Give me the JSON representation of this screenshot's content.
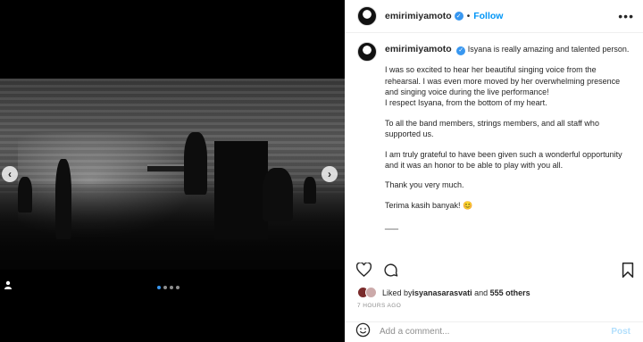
{
  "post": {
    "username": "emirimiyamoto",
    "follow_label": "Follow",
    "more_label": "•••",
    "caption": {
      "first_line": "Isyana is really amazing and talented person.",
      "paragraphs": [
        "I was so excited to hear her beautiful singing voice from the rehearsal. I was even more moved by her overwhelming presence and singing voice during the live performance!\nI respect Isyana, from the bottom of my heart.",
        "To all the band members, strings members, and all staff who supported us.",
        "I am truly grateful to have been given such a wonderful opportunity and it was an honor to be able to play with you all.",
        "Thank you very much.",
        "Terima kasih banyak! 😊",
        "___"
      ]
    },
    "likes": {
      "prefix": "Liked by ",
      "user": "isyanasarasvati",
      "middle": " and ",
      "count": "555 others"
    },
    "timestamp": "7 HOURS AGO",
    "comment": {
      "placeholder": "Add a comment...",
      "post_label": "Post"
    }
  },
  "media": {
    "carousel_total": 4,
    "carousel_active": 0,
    "prev_icon": "chevron-left-icon",
    "next_icon": "chevron-right-icon",
    "tag_icon": "user-tag-icon"
  },
  "icons": {
    "like": "heart-icon",
    "comment": "comment-icon",
    "share": "share-icon",
    "save": "bookmark-icon",
    "emoji": "emoji-icon"
  },
  "colors": {
    "link": "#0095f6",
    "verified": "#3897f0",
    "muted": "#8e8e8e",
    "post_disabled": "#b2dffc"
  }
}
